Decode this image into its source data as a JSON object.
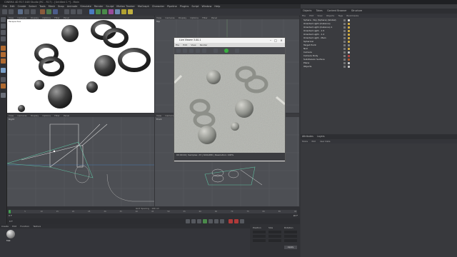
{
  "window": {
    "title": "CINEMA 4D R17.048 Studio (RC - R17) - [Untitled 1 *] - Main"
  },
  "menu": [
    "File",
    "Edit",
    "Create",
    "Select",
    "Tools",
    "Mesh",
    "Snap",
    "Animate",
    "Simulate",
    "Render",
    "Sculpt",
    "Motion Tracker",
    "MoGraph",
    "Character",
    "Pipeline",
    "Plugins",
    "Script",
    "Window",
    "Help"
  ],
  "layout": {
    "label": "Layout:",
    "value": "Startup (User)"
  },
  "viewports": {
    "perspective": {
      "menu": [
        "View",
        "Cameras",
        "Display",
        "Options",
        "Filter",
        "Panel"
      ],
      "label": "Perspective"
    },
    "top": {
      "menu": [
        "View",
        "Cameras",
        "Display",
        "Options",
        "Filter",
        "Panel"
      ],
      "label": "Top"
    },
    "right": {
      "menu": [
        "View",
        "Cameras",
        "Display",
        "Options",
        "Filter",
        "Panel"
      ],
      "label": "Right"
    },
    "front": {
      "menu": [
        "View",
        "Cameras",
        "Display",
        "Options",
        "Filter",
        "Panel"
      ],
      "label": "Front"
    }
  },
  "timeline": {
    "grid_spacing": "Grid Spacing : 100 cm",
    "start": "0 F",
    "end": "90 F",
    "current": "0 F",
    "ticks": [
      "0",
      "5",
      "10",
      "15",
      "20",
      "25",
      "30",
      "35",
      "40",
      "45",
      "50",
      "55",
      "60",
      "65",
      "70",
      "75",
      "80",
      "85",
      "90"
    ]
  },
  "materials": {
    "menu": [
      "Create",
      "Edit",
      "Function",
      "Texture"
    ],
    "item": "Mat"
  },
  "coords": {
    "headers": [
      "Position",
      "Size",
      "Rotation"
    ],
    "apply": "Apply"
  },
  "object_manager": {
    "tabs": [
      "Objects",
      "Takes",
      "Content Browser",
      "Structure"
    ],
    "menu": [
      "File",
      "Edit",
      "View",
      "Objects",
      "Tags",
      "Bookmarks"
    ],
    "objects": [
      {
        "name": "Sphere - Sky (Sphere) (Global)",
        "tag": "#d8d8d8"
      },
      {
        "name": "Oriented Light (Instance)",
        "tag": "#d8b040"
      },
      {
        "name": "Oriented Light (Instance) 1",
        "tag": "#d8b040"
      },
      {
        "name": "Oriented Light - 1.5",
        "tag": "#d8b040"
      },
      {
        "name": "Oriented Light - 1.2",
        "tag": "#d8b040"
      },
      {
        "name": "Oriented Light - Main",
        "tag": "#d8b040"
      },
      {
        "name": "Spherical",
        "tag": "#d8b040"
      },
      {
        "name": "Target Point",
        "tag": "#888888"
      },
      {
        "name": "Null",
        "tag": "#d8b040"
      },
      {
        "name": "Camera",
        "tag": "#c9c9c9"
      },
      {
        "name": "Camera Dolly",
        "tag": "#c04040"
      },
      {
        "name": "Subdivision Surface",
        "tag": "#b35a2a"
      },
      {
        "name": "Plane",
        "tag": "#c9c9c9"
      },
      {
        "name": "Objects",
        "tag": "#c9c9c9"
      }
    ]
  },
  "attribute_manager": {
    "tabs": [
      "Attributes",
      "Layers"
    ],
    "menu": [
      "Mode",
      "Edit",
      "User Data"
    ]
  },
  "render_window": {
    "title": "Live Viewer 3.00.1",
    "menu": [
      "File",
      "Edit",
      "View",
      "Render"
    ],
    "status": "00:00:02 | Samples: 23 | 640x480 | Resolution: 100%"
  },
  "icons": {
    "minimize": "minimize-icon",
    "maximize": "maximize-icon",
    "close": "close-icon",
    "play": "play-icon"
  }
}
